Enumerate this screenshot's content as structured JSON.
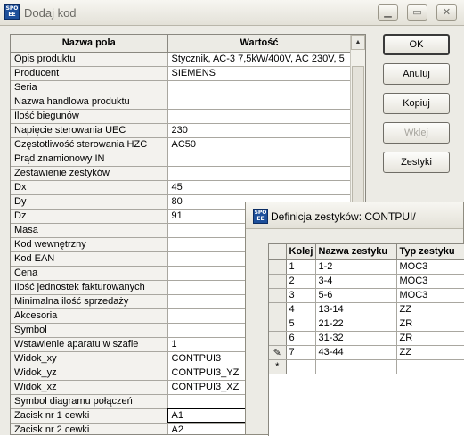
{
  "window": {
    "title": "Dodaj kod",
    "icon_label": "SPO EE"
  },
  "grid": {
    "col_name": "Nazwa pola",
    "col_value": "Wartość",
    "rows": [
      {
        "name": "Opis produktu",
        "value": "Stycznik, AC-3 7,5kW/400V, AC 230V, 5"
      },
      {
        "name": "Producent",
        "value": "SIEMENS"
      },
      {
        "name": "Seria",
        "value": ""
      },
      {
        "name": "Nazwa handlowa produktu",
        "value": ""
      },
      {
        "name": "Ilość biegunów",
        "value": ""
      },
      {
        "name": "Napięcie sterowania UEC",
        "value": "230"
      },
      {
        "name": "Częstotliwość sterowania HZC",
        "value": "AC50"
      },
      {
        "name": "Prąd znamionowy IN",
        "value": ""
      },
      {
        "name": "Zestawienie zestyków",
        "value": ""
      },
      {
        "name": "Dx",
        "value": "45"
      },
      {
        "name": "Dy",
        "value": "80"
      },
      {
        "name": "Dz",
        "value": "91"
      },
      {
        "name": "Masa",
        "value": ""
      },
      {
        "name": "Kod wewnętrzny",
        "value": ""
      },
      {
        "name": "Kod EAN",
        "value": ""
      },
      {
        "name": "Cena",
        "value": ""
      },
      {
        "name": "Ilość jednostek fakturowanych",
        "value": ""
      },
      {
        "name": "Minimalna ilość sprzedaży",
        "value": ""
      },
      {
        "name": "Akcesoria",
        "value": ""
      },
      {
        "name": "Symbol",
        "value": ""
      },
      {
        "name": "Wstawienie aparatu w szafie",
        "value": "1"
      },
      {
        "name": "Widok_xy",
        "value": "CONTPUI3"
      },
      {
        "name": "Widok_yz",
        "value": "CONTPUI3_YZ"
      },
      {
        "name": "Widok_xz",
        "value": "CONTPUI3_XZ"
      },
      {
        "name": "Symbol diagramu połączeń",
        "value": ""
      },
      {
        "name": "Zacisk nr 1 cewki",
        "value": "A1"
      },
      {
        "name": "Zacisk nr 2 cewki",
        "value": "A2"
      }
    ]
  },
  "buttons": {
    "ok": "OK",
    "cancel": "Anuluj",
    "copy": "Kopiuj",
    "paste": "Wklej",
    "contacts": "Zestyki"
  },
  "child": {
    "title": "Definicja zestyków: CONTPUI/",
    "icon_label": "SPO EE",
    "columns": [
      "Kolej",
      "Nazwa zestyku",
      "Typ zestyku"
    ],
    "rows": [
      {
        "order": "1",
        "name": "1-2",
        "type": "MOC3"
      },
      {
        "order": "2",
        "name": "3-4",
        "type": "MOC3"
      },
      {
        "order": "3",
        "name": "5-6",
        "type": "MOC3"
      },
      {
        "order": "4",
        "name": "13-14",
        "type": "ZZ"
      },
      {
        "order": "5",
        "name": "21-22",
        "type": "ZR"
      },
      {
        "order": "6",
        "name": "31-32",
        "type": "ZR"
      },
      {
        "order": "7",
        "name": "43-44",
        "type": "ZZ"
      }
    ],
    "new_row_marker": "*",
    "edit_marker": "✎"
  },
  "icons": {
    "minimize": "minimize-icon",
    "maximize": "maximize-icon",
    "close": "close-icon"
  }
}
